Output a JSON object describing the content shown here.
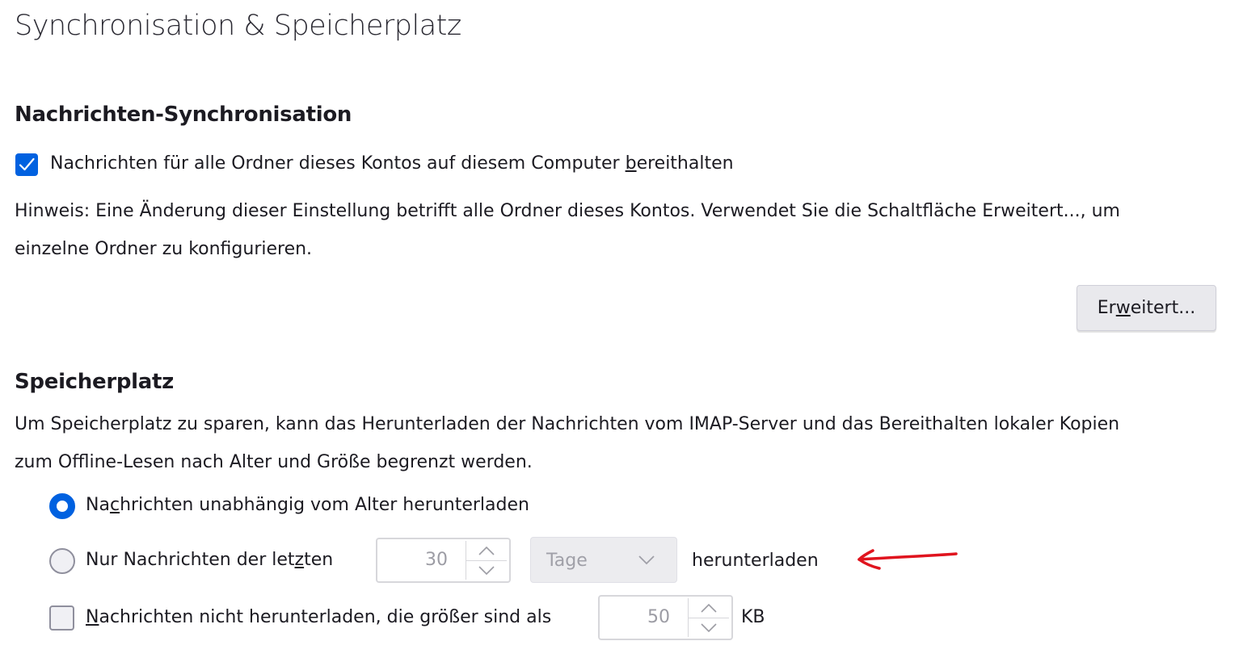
{
  "page": {
    "title": "Synchronisation & Speicherplatz"
  },
  "sync": {
    "heading": "Nachrichten-Synchronisation",
    "keep_messages": {
      "checked": true,
      "label_pre": "Nachrichten für alle Ordner dieses Kontos auf diesem Computer ",
      "label_accel": "b",
      "label_post": "ereithalten"
    },
    "hint_line1": "Hinweis: Eine Änderung dieser Einstellung betrifft alle Ordner dieses Kontos. Verwendet Sie die Schaltfläche Erweitert..., um",
    "hint_line2": "einzelne Ordner zu konfigurieren.",
    "advanced_button": {
      "pre": "Er",
      "accel": "w",
      "post": "eitert..."
    }
  },
  "storage": {
    "heading": "Speicherplatz",
    "description_line1": "Um Speicherplatz zu sparen, kann das Herunterladen der Nachrichten vom IMAP-Server und das Bereithalten lokaler Kopien",
    "description_line2": "zum Offline-Lesen nach Alter und Größe begrenzt werden.",
    "option_all": {
      "selected": true,
      "label_pre": "Na",
      "label_accel": "c",
      "label_post": "hrichten unabhängig vom Alter herunterladen"
    },
    "option_recent": {
      "selected": false,
      "label_pre": "Nur Nachrichten der let",
      "label_accel": "z",
      "label_post": "ten",
      "age_value": "30",
      "age_unit": "Tage",
      "suffix": "herunterladen"
    },
    "size_limit": {
      "checked": false,
      "label_accel": "N",
      "label_post": "achrichten nicht herunterladen, die größer sind als",
      "size_value": "50",
      "unit": "KB"
    }
  },
  "annotation": {
    "color": "#e0141e"
  },
  "colors": {
    "accent": "#0061e0",
    "text": "#1c1b22"
  }
}
